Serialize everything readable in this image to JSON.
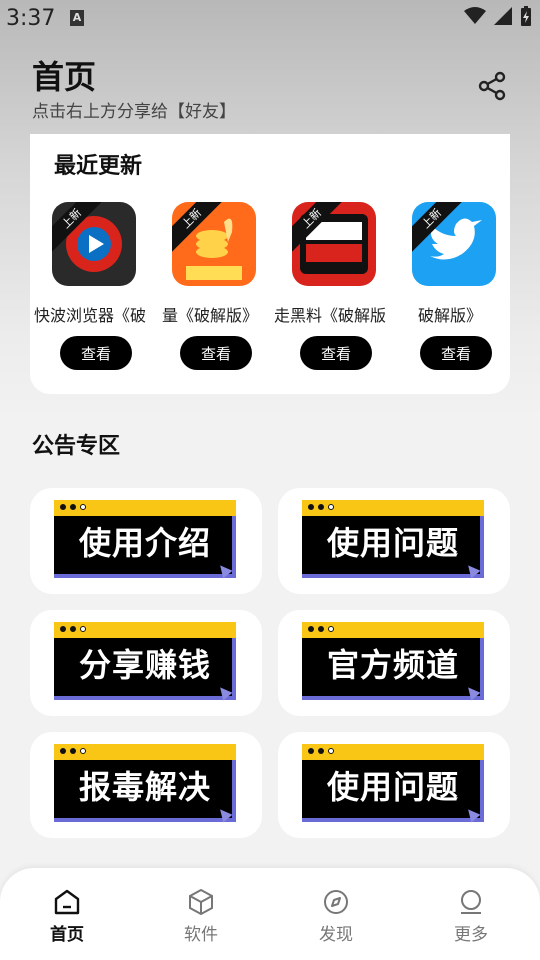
{
  "status_bar": {
    "time": "3:37"
  },
  "header": {
    "title": "首页",
    "subtitle": "点击右上方分享给【好友】"
  },
  "recent": {
    "heading": "最近更新",
    "ribbon": "上新",
    "view_label": "查看",
    "apps": [
      {
        "name": "快波浏览器《破",
        "icon_bg": "#2a2a2a",
        "icon_name": "play-icon"
      },
      {
        "name": "量《破解版》",
        "icon_bg": "#ff6b1a",
        "icon_name": "coin-hand-icon"
      },
      {
        "name": "走黑料《破解版",
        "icon_bg": "#d8241c",
        "icon_name": "news-icon"
      },
      {
        "name": "破解版》",
        "icon_bg": "#1da1f2",
        "icon_name": "bird-icon"
      }
    ]
  },
  "notices": {
    "heading": "公告专区",
    "tiles": [
      {
        "label": "使用介绍"
      },
      {
        "label": "使用问题"
      },
      {
        "label": "分享赚钱"
      },
      {
        "label": "官方频道"
      },
      {
        "label": "报毒解决"
      },
      {
        "label": "使用问题"
      }
    ]
  },
  "nav": {
    "items": [
      {
        "label": "首页",
        "icon": "home-icon",
        "active": true
      },
      {
        "label": "软件",
        "icon": "box-icon",
        "active": false
      },
      {
        "label": "发现",
        "icon": "compass-icon",
        "active": false
      },
      {
        "label": "更多",
        "icon": "user-icon",
        "active": false
      }
    ]
  },
  "colors": {
    "accent": "#000000",
    "banner_yellow": "#f9c616",
    "banner_border": "#6b6bd8"
  }
}
